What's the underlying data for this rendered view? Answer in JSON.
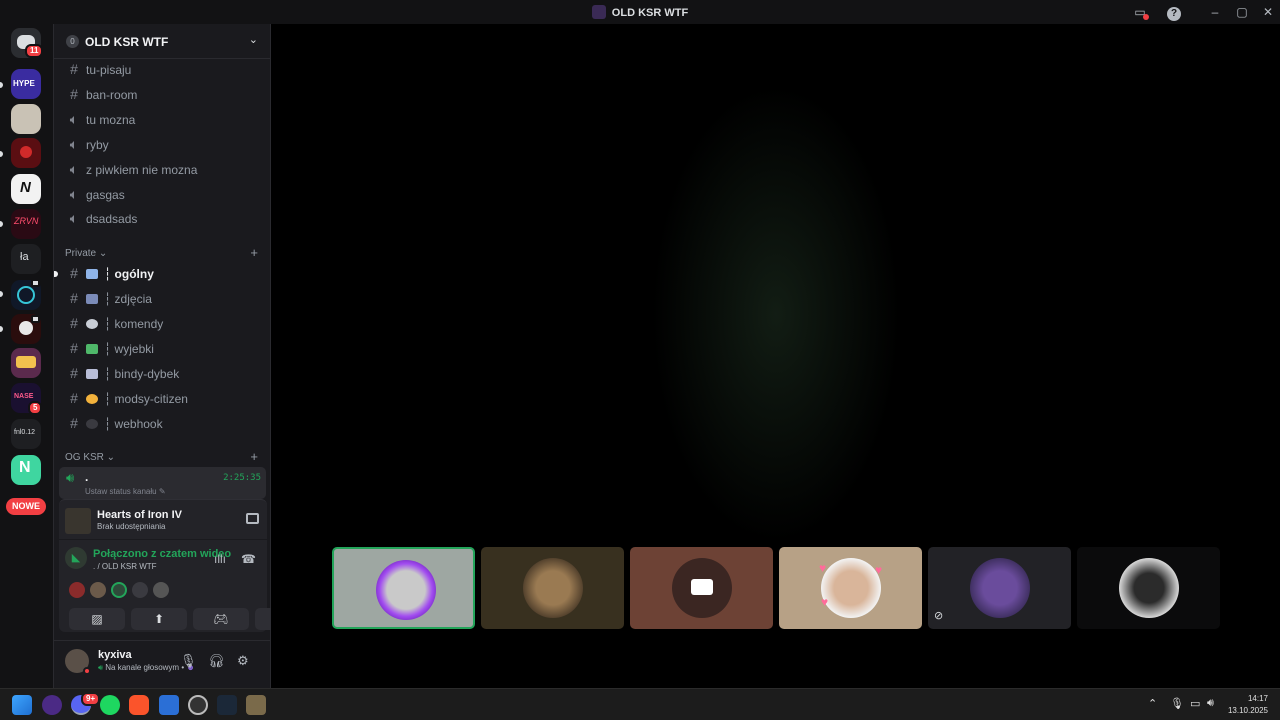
{
  "window": {
    "title": "OLD KSR WTF",
    "controls": [
      "monitor-icon",
      "help-icon",
      "minimize-icon",
      "maximize-icon",
      "close-icon"
    ]
  },
  "rail": {
    "dm_badge": "11",
    "servers": [
      {
        "name": "HYPE",
        "label": "HYPE"
      },
      {
        "name": "server-3",
        "label": ""
      },
      {
        "name": "server-4",
        "label": ""
      },
      {
        "name": "server-5",
        "label": "N"
      },
      {
        "name": "server-6",
        "label": ""
      },
      {
        "name": "la",
        "label": "ła"
      },
      {
        "name": "server-8",
        "label": ""
      },
      {
        "name": "server-9",
        "label": ""
      },
      {
        "name": "server-10",
        "label": ""
      },
      {
        "name": "server-11",
        "label": "",
        "badge": "5"
      },
      {
        "name": "fnl012",
        "label": "fnl0.12"
      },
      {
        "name": "server-13",
        "label": ""
      }
    ],
    "new_label": "NOWE"
  },
  "server": {
    "name": "OLD KSR WTF",
    "channels_top": [
      {
        "type": "text",
        "name": "tu-pisaju"
      },
      {
        "type": "text",
        "name": "ban-room"
      },
      {
        "type": "voice",
        "name": "tu mozna"
      },
      {
        "type": "voice",
        "name": "ryby"
      },
      {
        "type": "voice",
        "name": "z piwkiem nie mozna"
      },
      {
        "type": "voice",
        "name": "gasgas"
      },
      {
        "type": "voice",
        "name": "dsadsads"
      }
    ],
    "category_private": "Private",
    "private_channels": [
      {
        "name": "┆ ogólny",
        "unread": true,
        "emoji_color": "#8fb4e8"
      },
      {
        "name": "┆ zdjęcia",
        "unread": false,
        "emoji_color": "#7b8bb8"
      },
      {
        "name": "┆ komendy",
        "unread": false,
        "emoji_color": "#c9ced6"
      },
      {
        "name": "┆ wyjebki",
        "unread": false,
        "emoji_color": "#4fb86a"
      },
      {
        "name": "┆ bindy-dybek",
        "unread": false,
        "emoji_color": "#b9bed8"
      },
      {
        "name": "┆ modsy-citizen",
        "unread": false,
        "emoji_color": "#f3b23c"
      },
      {
        "name": "┆ webhook",
        "unread": false,
        "emoji_color": "#3a3a40"
      }
    ],
    "category_og": "OG KSR",
    "voice_channel": {
      "name": ".",
      "timer": "2:25:35",
      "status": "Ustaw status kanału"
    }
  },
  "activity": {
    "game": "Hearts of Iron IV",
    "sub": "Brak udostępniania"
  },
  "voice_connection": {
    "title": "Połączono z czatem wideo",
    "sub": ". / OLD KSR WTF"
  },
  "user": {
    "name": "kyxiva",
    "status": "Na kanale głosowym •"
  },
  "taskbar": {
    "time": "14:17",
    "date": "13.10.2025",
    "discord_badge": "9+"
  },
  "colors": {
    "accent_green": "#23a55a",
    "danger": "#f23f43",
    "sidebar_bg": "#1a1a1e",
    "rail_bg": "#121214"
  }
}
